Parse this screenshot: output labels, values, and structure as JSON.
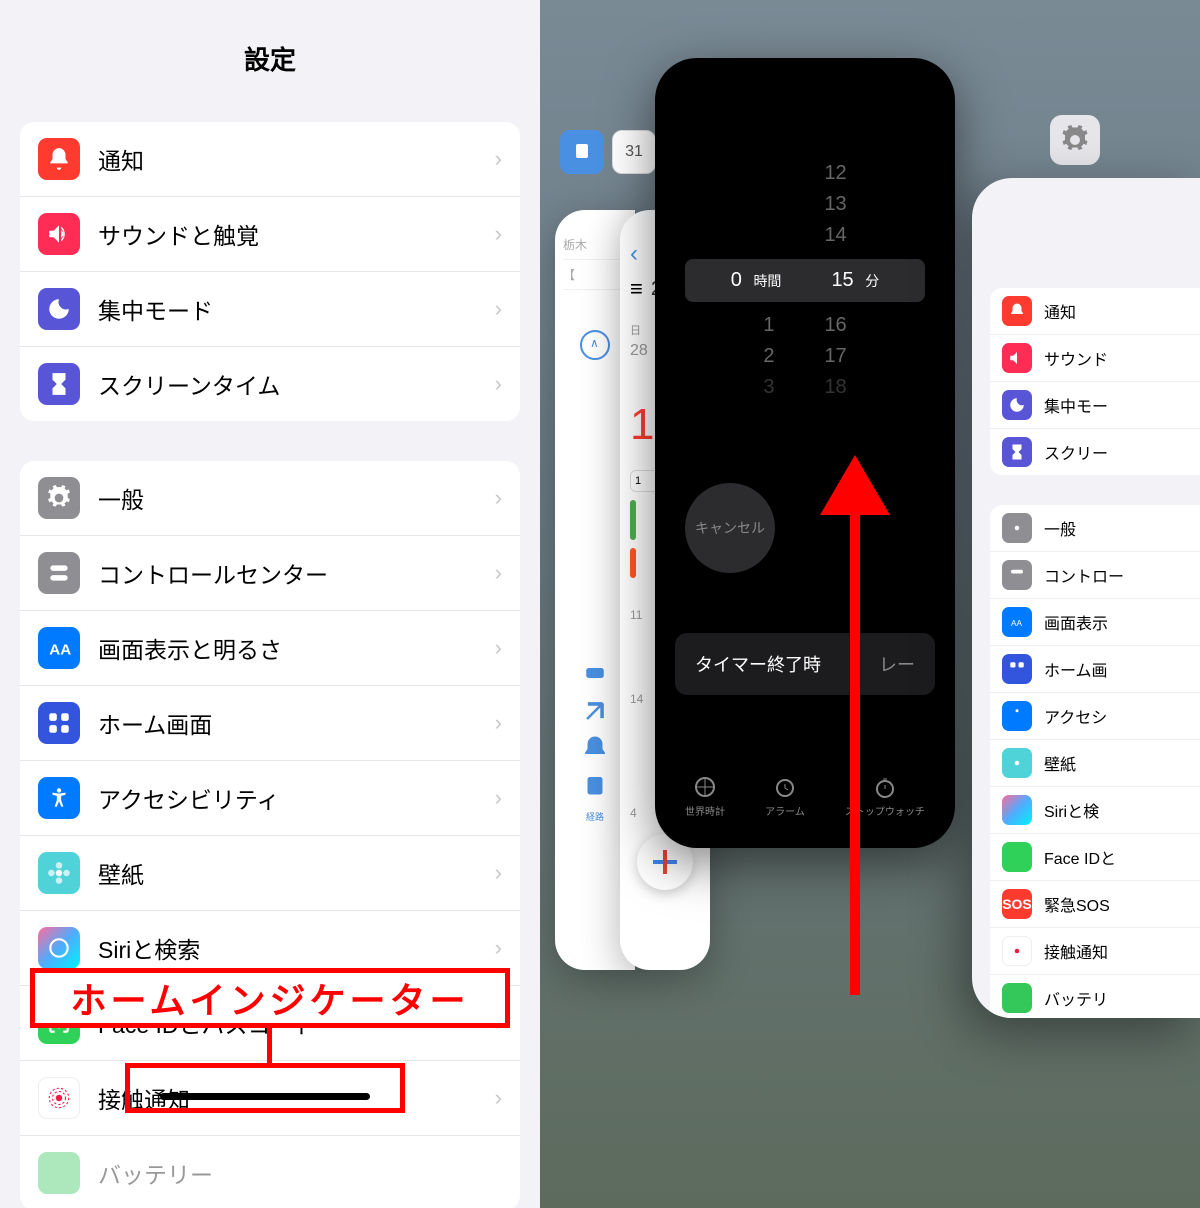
{
  "left_panel": {
    "title": "設定",
    "group1": [
      {
        "label": "通知",
        "icon": "notification"
      },
      {
        "label": "サウンドと触覚",
        "icon": "sound"
      },
      {
        "label": "集中モード",
        "icon": "focus"
      },
      {
        "label": "スクリーンタイム",
        "icon": "screentime"
      }
    ],
    "group2": [
      {
        "label": "一般",
        "icon": "general"
      },
      {
        "label": "コントロールセンター",
        "icon": "control"
      },
      {
        "label": "画面表示と明るさ",
        "icon": "display"
      },
      {
        "label": "ホーム画面",
        "icon": "home"
      },
      {
        "label": "アクセシビリティ",
        "icon": "accessibility"
      },
      {
        "label": "壁紙",
        "icon": "wallpaper"
      },
      {
        "label": "Siriと検索",
        "icon": "siri"
      },
      {
        "label": "Face IDとパスコード",
        "icon": "faceid"
      },
      {
        "label": "接触通知",
        "icon": "exposure"
      },
      {
        "label": "バッテリー",
        "icon": "battery"
      }
    ],
    "annotation_label": "ホームインジケーター"
  },
  "right_panel": {
    "calendar_mini_day": "31",
    "calendar_header": "2",
    "calendar_day": "1",
    "clock_app": {
      "picker_values": [
        "12",
        "13",
        "14"
      ],
      "selected_hours": "0",
      "hours_label": "時間",
      "selected_min": "15",
      "min_label": "分",
      "picker_after": [
        "16",
        "17",
        "18"
      ],
      "picker_before_num": [
        "1",
        "2",
        "3"
      ],
      "cancel": "キャンセル",
      "timer_end": "タイマー終了時",
      "timer_end_right": "レー",
      "tabs": [
        "世界時計",
        "アラーム",
        "ストップウォッチ"
      ]
    },
    "settings_card": {
      "group1": [
        {
          "label": "通知",
          "icon": "notification"
        },
        {
          "label": "サウンド",
          "icon": "sound"
        },
        {
          "label": "集中モー",
          "icon": "focus"
        },
        {
          "label": "スクリー",
          "icon": "screentime"
        }
      ],
      "group2": [
        {
          "label": "一般",
          "icon": "general"
        },
        {
          "label": "コントロー",
          "icon": "control"
        },
        {
          "label": "画面表示",
          "icon": "display"
        },
        {
          "label": "ホーム画",
          "icon": "home"
        },
        {
          "label": "アクセシ",
          "icon": "accessibility"
        },
        {
          "label": "壁紙",
          "icon": "wallpaper"
        },
        {
          "label": "Siriと検",
          "icon": "siri"
        },
        {
          "label": "Face IDと",
          "icon": "faceid"
        },
        {
          "label": "緊急SOS",
          "icon": "sos"
        },
        {
          "label": "接触通知",
          "icon": "exposure"
        },
        {
          "label": "バッテリ",
          "icon": "battery"
        }
      ]
    }
  }
}
